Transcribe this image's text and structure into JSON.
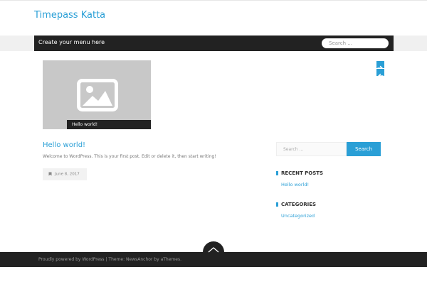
{
  "site": {
    "title": "Timepass Katta"
  },
  "nav": {
    "menu_label": "Create your menu here",
    "search_placeholder": "Search ..."
  },
  "slider": {
    "caption": "Hello world!",
    "next_icon": "arrow-right-icon",
    "prev_icon": "arrow-left-icon"
  },
  "post": {
    "title": "Hello world!",
    "excerpt": "Welcome to WordPress. This is your first post. Edit or delete it, then start writing!",
    "date": "June 8, 2017"
  },
  "sidebar": {
    "search_placeholder": "Search ...",
    "search_button": "Search",
    "recent_posts_heading": "RECENT POSTS",
    "recent_posts": [
      "Hello world!"
    ],
    "categories_heading": "CATEGORIES",
    "categories": [
      "Uncategorized"
    ]
  },
  "footer": {
    "prefix": "Proudly powered by ",
    "wordpress_link": "WordPress",
    "separator": " | Theme: ",
    "theme_link": "NewsAnchor",
    "by_text": " by ",
    "author_link": "aThemes",
    "suffix": ".",
    "back_to_top_icon": "chevron-up-icon"
  },
  "colors": {
    "accent": "#2a9fd6",
    "dark": "#222222",
    "placeholder_bg": "#c8c8c8"
  }
}
